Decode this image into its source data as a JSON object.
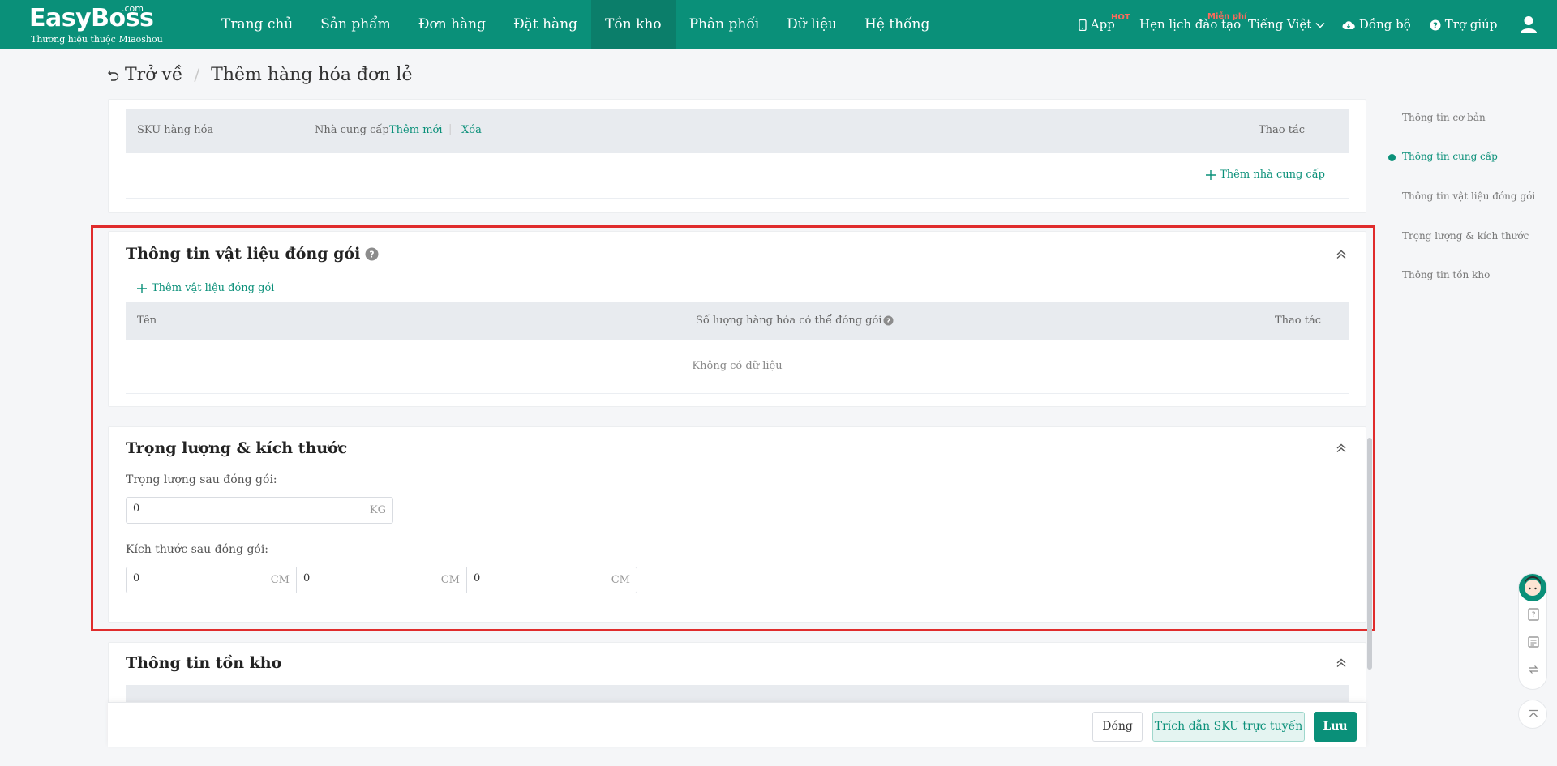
{
  "brand": {
    "name": "EasyBoss",
    "suffix": ".com",
    "tagline": "Thương hiệu thuộc Miaoshou"
  },
  "nav": {
    "items": [
      {
        "label": "Trang chủ"
      },
      {
        "label": "Sản phẩm"
      },
      {
        "label": "Đơn hàng"
      },
      {
        "label": "Đặt hàng"
      },
      {
        "label": "Tồn kho",
        "active": true
      },
      {
        "label": "Phân phối"
      },
      {
        "label": "Dữ liệu"
      },
      {
        "label": "Hệ thống"
      }
    ]
  },
  "header_right": {
    "app_label": "App",
    "app_badge": "HOT",
    "training_label": "Hẹn lịch đào tạo",
    "training_badge": "Miễn phí",
    "language": "Tiếng Việt",
    "sync_label": "Đồng bộ",
    "help_label": "Trợ giúp"
  },
  "breadcrumb": {
    "back": "Trở về",
    "separator": "/",
    "current": "Thêm hàng hóa đơn lẻ"
  },
  "supplier_section": {
    "columns": {
      "sku": "SKU hàng hóa",
      "supplier": "Nhà cung cấp",
      "add_new": "Thêm mới",
      "delete": "Xóa",
      "actions": "Thao tác"
    },
    "add_supplier": "Thêm nhà cung cấp"
  },
  "packaging_section": {
    "title": "Thông tin vật liệu đóng gói",
    "add_material": "Thêm vật liệu đóng gói",
    "columns": {
      "name": "Tên",
      "quantity": "Số lượng hàng hóa có thể đóng gói",
      "actions": "Thao tác"
    },
    "empty": "Không có dữ liệu"
  },
  "weight_section": {
    "title": "Trọng lượng & kích thước",
    "weight_label": "Trọng lượng sau đóng gói:",
    "weight_value": "0",
    "weight_unit": "KG",
    "size_label": "Kích thước sau đóng gói:",
    "dimensions": [
      {
        "value": "0",
        "unit": "CM"
      },
      {
        "value": "0",
        "unit": "CM"
      },
      {
        "value": "0",
        "unit": "CM"
      }
    ]
  },
  "stock_section": {
    "title": "Thông tin tồn kho"
  },
  "anchor_nav": {
    "items": [
      {
        "label": "Thông tin cơ bản"
      },
      {
        "label": "Thông tin cung cấp",
        "active": true
      },
      {
        "label": "Thông tin vật liệu đóng gói"
      },
      {
        "label": "Trọng lượng & kích thước"
      },
      {
        "label": "Thông tin tồn kho"
      }
    ]
  },
  "footer": {
    "close": "Đóng",
    "import_sku": "Trích dẫn SKU trực tuyến",
    "save": "Lưu"
  },
  "colors": {
    "primary": "#0a9079",
    "highlight": "#e02c2c",
    "badge": "#ff6a5c"
  }
}
